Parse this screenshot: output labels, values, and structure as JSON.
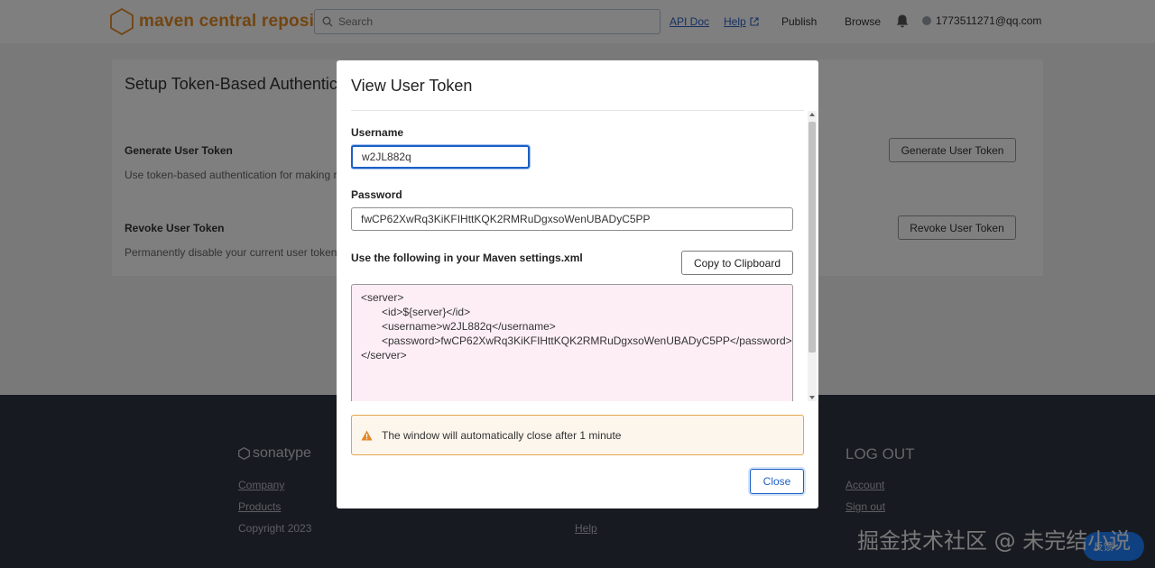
{
  "header": {
    "logo_text": "maven central repository",
    "search_placeholder": "Search",
    "nav": {
      "api_doc": "API Doc",
      "help": "Help",
      "publish": "Publish",
      "browse": "Browse"
    },
    "user_email": "1773511271@qq.com"
  },
  "page": {
    "title": "Setup Token-Based Authenticat",
    "generate": {
      "title": "Generate User Token",
      "description": "Use token-based authentication for making req",
      "button": "Generate User Token"
    },
    "revoke": {
      "title": "Revoke User Token",
      "description": "Permanently disable your current user token. A",
      "button": "Revoke User Token"
    }
  },
  "footer": {
    "brand": "sonatype",
    "company": "Company",
    "products": "Products",
    "copyright": "Copyright 2023",
    "help": "Help",
    "logout_heading": "LOG OUT",
    "account": "Account",
    "sign_out": "Sign out",
    "watermark": "掘金技术社区 @ 未完结小说",
    "fab_label": "反馈"
  },
  "modal": {
    "title": "View User Token",
    "username_label": "Username",
    "username_value": "w2JL882q",
    "password_label": "Password",
    "password_value": "fwCP62XwRq3KiKFIHttKQK2RMRuDgxsoWenUBADyC5PP",
    "settings_label": "Use the following in your Maven settings.xml",
    "copy_button": "Copy to Clipboard",
    "xml_lines": [
      "<server>",
      "<id>${server}</id>",
      "<username>w2JL882q</username>",
      "<password>fwCP62XwRq3KiKFIHttKQK2RMRuDgxsoWenUBADyC5PP</password>",
      "</server>"
    ],
    "warning": "The window will automatically close after 1 minute",
    "close_button": "Close"
  },
  "colors": {
    "brand_orange": "#e58a23",
    "link_blue": "#2f63c7",
    "focus_blue": "#1d5fc4",
    "warning_border": "#e1a550",
    "xml_background": "#fdeef6",
    "footer_background": "#2f3541"
  },
  "icons": {
    "logo": "hexagon-logo-icon",
    "search": "search-icon",
    "external_link": "external-link-icon",
    "notifications": "bell-icon",
    "warning": "warning-triangle-icon"
  }
}
